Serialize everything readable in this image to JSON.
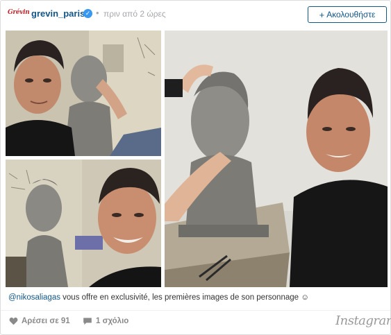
{
  "header": {
    "logo_text": "Grévin",
    "username": "grevin_paris",
    "verified_icon": "verified-badge-icon",
    "separator": "•",
    "time_ago": "πριν από 2 ώρες",
    "follow_label": "Ακολουθήστε",
    "follow_icon": "+"
  },
  "photos": [
    {
      "name": "photo-man-with-sculptor"
    },
    {
      "name": "photo-man-smiling-with-bust"
    },
    {
      "name": "photo-man-posing-with-bust"
    }
  ],
  "caption": {
    "mention": "@nikosaliagas",
    "text": " vous offre en exclusivité, les premières images de son personnage ☺"
  },
  "footer": {
    "likes_label": "Αρέσει σε 91",
    "comments_label": "1 σχόλιο",
    "brand": "Instagram",
    "heart_icon": "heart-icon",
    "comment_icon": "comment-bubble-icon"
  },
  "colors": {
    "link": "#125688",
    "muted": "#a5a7aa",
    "verified": "#3897f0",
    "logo": "#c4262e"
  }
}
